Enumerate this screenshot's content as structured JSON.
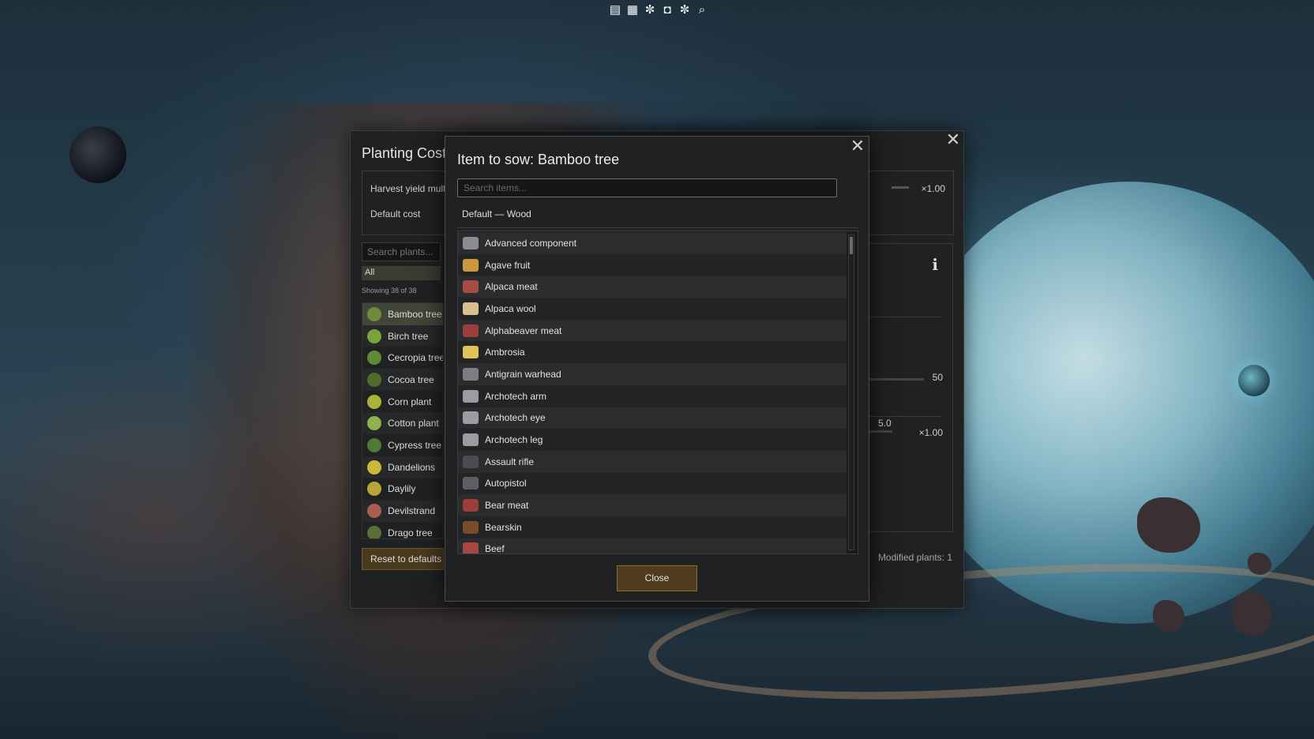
{
  "toolbar": {
    "icons": [
      "log-icon",
      "table-icon",
      "gear-icon",
      "screenshot-icon",
      "settings-icon",
      "search-icon"
    ]
  },
  "back_panel": {
    "title": "Planting Costs",
    "harvest_label": "Harvest yield multiplier",
    "harvest_value": "×1.00",
    "default_cost_label": "Default cost",
    "search_placeholder": "Search plants...",
    "filter_all": "All",
    "showing": "Showing 38 of 38",
    "plants": [
      {
        "name": "Bamboo tree",
        "color": "#6f8a3a",
        "selected": true
      },
      {
        "name": "Birch tree",
        "color": "#7aa33b"
      },
      {
        "name": "Cecropia tree",
        "color": "#5f8a34"
      },
      {
        "name": "Cocoa tree",
        "color": "#4d6e2b"
      },
      {
        "name": "Corn plant",
        "color": "#a9b43a"
      },
      {
        "name": "Cotton plant",
        "color": "#8fb04a"
      },
      {
        "name": "Cypress tree",
        "color": "#4f7a35"
      },
      {
        "name": "Dandelions",
        "color": "#c9b93a"
      },
      {
        "name": "Daylily",
        "color": "#b9a43a"
      },
      {
        "name": "Devilstrand",
        "color": "#a85e52"
      },
      {
        "name": "Drago tree",
        "color": "#5a6e3a"
      }
    ],
    "reset_label": "Reset to defaults",
    "detail_val_1": "50",
    "detail_val_2": "5.0",
    "detail_val_3": "×1.00",
    "modified": "Modified plants: 1"
  },
  "dialog": {
    "title": "Item to sow: Bamboo tree",
    "search_placeholder": "Search items...",
    "default_line": "Default — Wood",
    "items": [
      {
        "name": "Advanced component",
        "color": "#8a8c90"
      },
      {
        "name": "Agave fruit",
        "color": "#c99a3a"
      },
      {
        "name": "Alpaca meat",
        "color": "#a64a44"
      },
      {
        "name": "Alpaca wool",
        "color": "#d8c08e"
      },
      {
        "name": "Alphabeaver meat",
        "color": "#9c3e3c"
      },
      {
        "name": "Ambrosia",
        "color": "#e0c25a"
      },
      {
        "name": "Antigrain warhead",
        "color": "#7c7e82"
      },
      {
        "name": "Archotech arm",
        "color": "#9a9ca0"
      },
      {
        "name": "Archotech eye",
        "color": "#9a9ca0"
      },
      {
        "name": "Archotech leg",
        "color": "#9a9ca0"
      },
      {
        "name": "Assault rifle",
        "color": "#4a4c50"
      },
      {
        "name": "Autopistol",
        "color": "#5c5e62"
      },
      {
        "name": "Bear meat",
        "color": "#9c3e3c"
      },
      {
        "name": "Bearskin",
        "color": "#7a4a2c"
      },
      {
        "name": "Beef",
        "color": "#a84644"
      }
    ],
    "close_label": "Close"
  }
}
